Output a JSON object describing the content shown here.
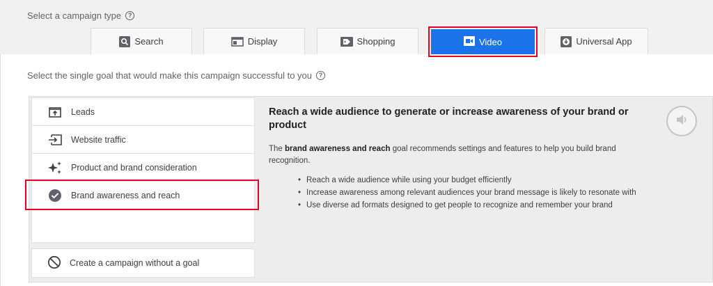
{
  "campaign_type": {
    "title": "Select a campaign type",
    "tabs": [
      {
        "label": "Search",
        "icon": "search-icon"
      },
      {
        "label": "Display",
        "icon": "display-icon"
      },
      {
        "label": "Shopping",
        "icon": "shopping-tag-icon"
      },
      {
        "label": "Video",
        "icon": "video-camera-icon",
        "selected": true
      },
      {
        "label": "Universal App",
        "icon": "download-app-icon"
      }
    ]
  },
  "goals": {
    "title": "Select the single goal that would make this campaign successful to you",
    "items": [
      {
        "label": "Leads",
        "icon": "leads-upload-icon"
      },
      {
        "label": "Website traffic",
        "icon": "website-traffic-icon"
      },
      {
        "label": "Product and brand consideration",
        "icon": "sparkle-icon"
      },
      {
        "label": "Brand awareness and reach",
        "icon": "check-circle-icon",
        "selected": true
      }
    ],
    "no_goal_label": "Create a campaign without a goal"
  },
  "detail": {
    "heading": "Reach a wide audience to generate or increase awareness of your brand or product",
    "desc_prefix": "The ",
    "desc_bold": "brand awareness and reach",
    "desc_suffix": " goal recommends settings and features to help you build brand recognition.",
    "bullets": [
      "Reach a wide audience while using your budget efficiently",
      "Increase awareness among relevant audiences your brand message is likely to resonate with",
      "Use diverse ad formats designed to get people to recognize and remember your brand"
    ]
  },
  "colors": {
    "accent": "#1a73e8",
    "highlight": "#e60023",
    "panel_bg": "#ededed"
  }
}
